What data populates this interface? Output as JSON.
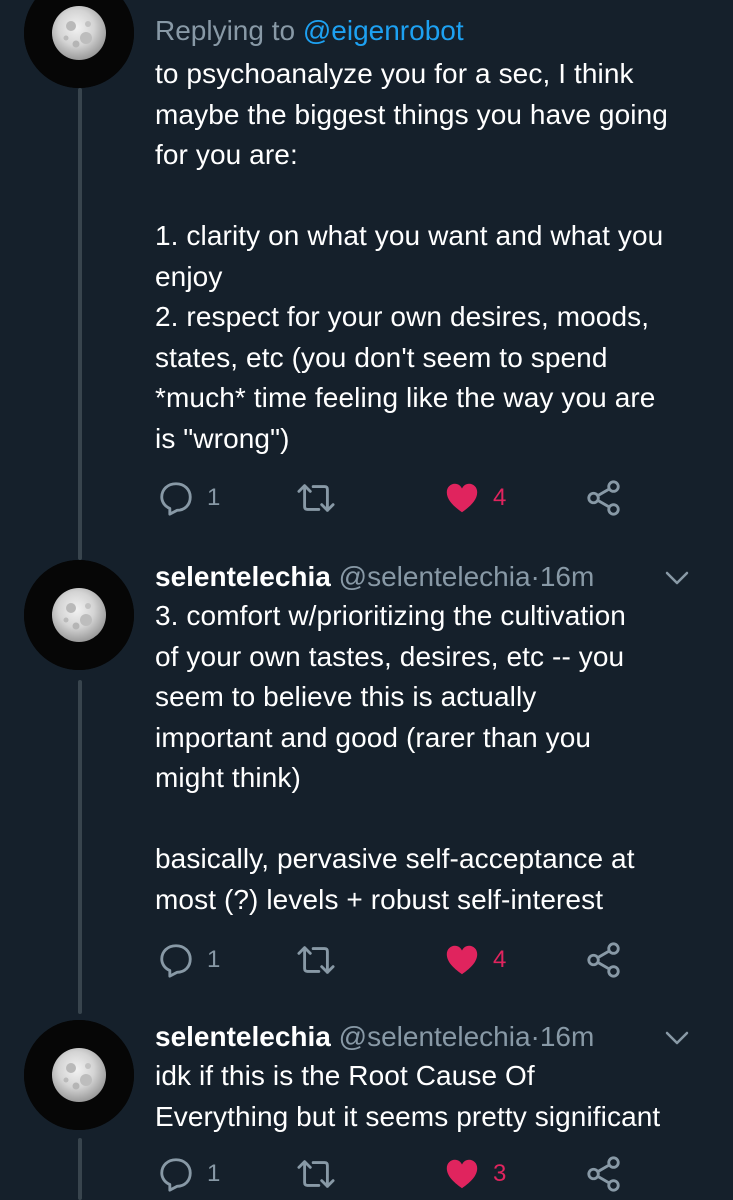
{
  "colors": {
    "background": "#15202b",
    "text": "#ffffff",
    "muted": "#8899a6",
    "link": "#1da1f2",
    "like": "#e0245e",
    "thread_line": "#38444d"
  },
  "tweets": [
    {
      "replying_prefix": "Replying to",
      "replying_to": "@eigenrobot",
      "text": "to psychoanalyze you for a sec, I think\nmaybe the biggest things you have going\nfor you are:\n\n1. clarity on what you want and what you\nenjoy\n2. respect for your own desires, moods,\nstates, etc (you don't seem to spend\n*much* time feeling like the way you are\nis \"wrong\")",
      "replies": "1",
      "likes": "4",
      "liked": true,
      "icons": [
        "reply-icon",
        "retweet-icon",
        "heart-icon",
        "share-icon"
      ]
    },
    {
      "display_name": "selentelechia",
      "handle": "@selentelechia",
      "separator": "·",
      "time": "16m",
      "text": "3. comfort w/prioritizing the cultivation\nof your own tastes, desires, etc -- you\nseem to believe this is actually\nimportant and good (rarer than you\nmight think)\n\nbasically, pervasive self-acceptance at\nmost (?) levels + robust self-interest",
      "replies": "1",
      "likes": "4",
      "liked": true,
      "icons": [
        "reply-icon",
        "retweet-icon",
        "heart-icon",
        "share-icon",
        "chevron-down-icon"
      ]
    },
    {
      "display_name": "selentelechia",
      "handle": "@selentelechia",
      "separator": "·",
      "time": "16m",
      "text": "idk if this is the Root Cause Of\nEverything but it seems pretty significant",
      "replies": "1",
      "likes": "3",
      "liked": true,
      "icons": [
        "reply-icon",
        "retweet-icon",
        "heart-icon",
        "share-icon",
        "chevron-down-icon"
      ]
    }
  ]
}
